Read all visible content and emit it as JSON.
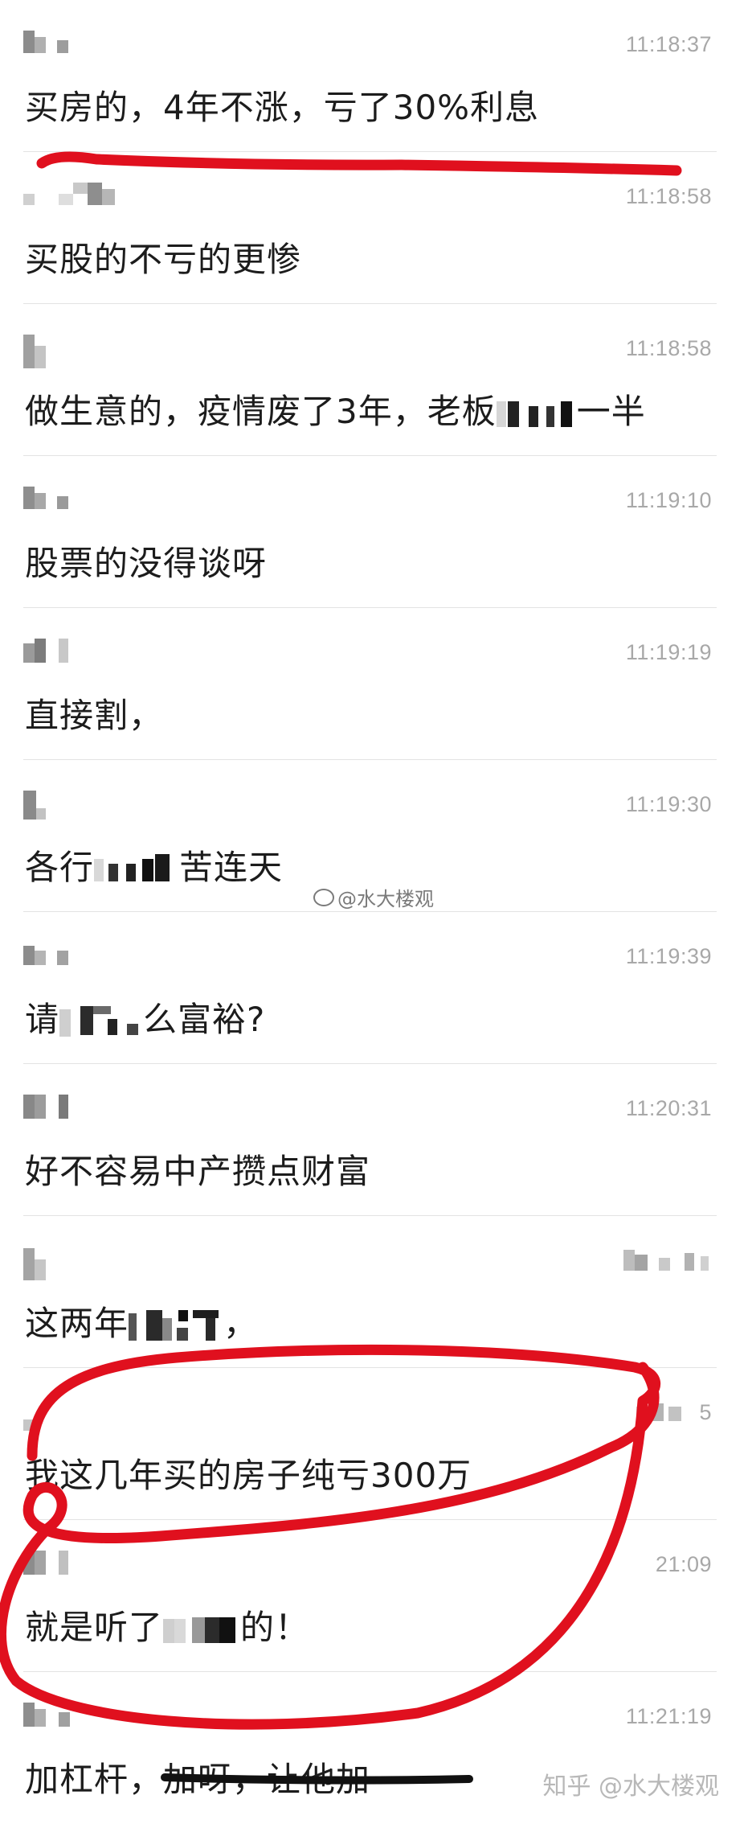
{
  "messages": [
    {
      "time": "11:18:37",
      "text_parts": [
        "买房的，4年不涨，亏了30%利息"
      ]
    },
    {
      "time": "11:18:58",
      "text_parts": [
        "买股的不亏的更惨"
      ]
    },
    {
      "time": "11:18:58",
      "text_parts": [
        "做生意的，疫情废了3年，老板",
        "一半"
      ]
    },
    {
      "time": "11:19:10",
      "text_parts": [
        "股票的没得谈呀"
      ]
    },
    {
      "time": "11:19:19",
      "text_parts": [
        "直接割，"
      ]
    },
    {
      "time": "11:19:30",
      "text_parts": [
        "各行",
        "苦连天"
      ]
    },
    {
      "time": "11:19:39",
      "text_parts": [
        "请",
        "么富裕?"
      ]
    },
    {
      "time": "11:20:31",
      "text_parts": [
        "好不容易中产攒点财富"
      ]
    },
    {
      "time": "",
      "text_parts": [
        "这两年",
        "，"
      ]
    },
    {
      "time": "5",
      "text_parts": [
        "我这几年买的房子纯亏300万"
      ]
    },
    {
      "time": "21:09",
      "text_parts": [
        "就是听了",
        "的！"
      ]
    },
    {
      "time": "11:21:19",
      "text_parts": [
        "加杠杆，加呀，让他加"
      ]
    }
  ],
  "watermark_mid": "@水大楼观",
  "watermark_bottom": "知乎 @水大楼观",
  "colors": {
    "annotation_red": "#e0101e",
    "divider": "#e3e3e3",
    "timestamp": "#a8a8a8",
    "text": "#1c1c1c"
  }
}
